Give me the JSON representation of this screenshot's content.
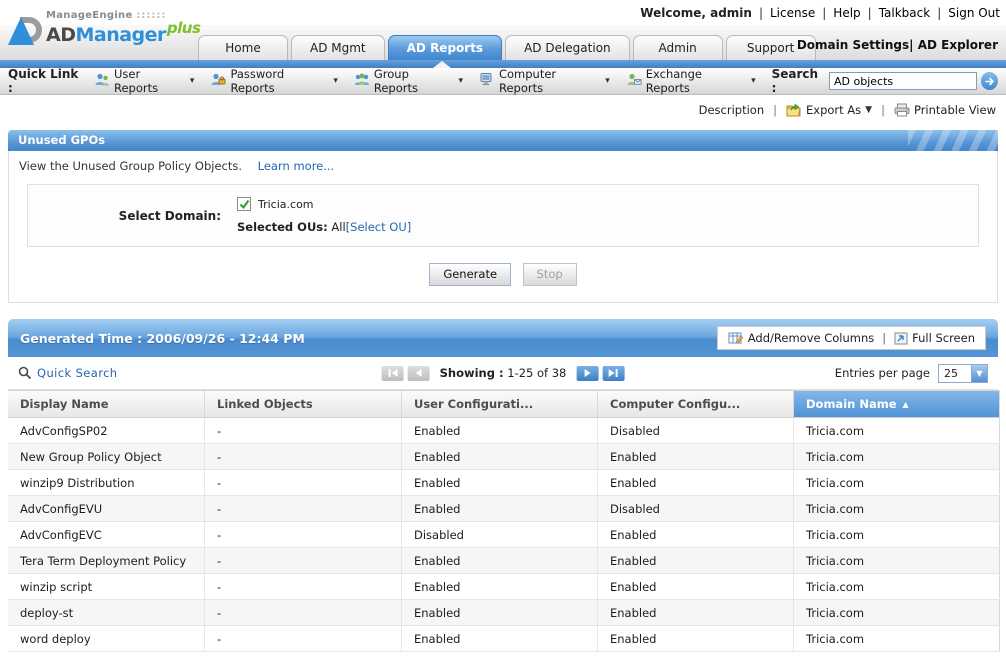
{
  "topbar": {
    "welcome": "Welcome, admin",
    "links": [
      "License",
      "Help",
      "Talkback",
      "Sign Out"
    ]
  },
  "brand": {
    "manage_engine": "ManageEngine",
    "dots": "::::::",
    "ad": "AD",
    "manager": "Manager",
    "plus": "plus"
  },
  "tabs": [
    {
      "label": "Home",
      "active": false
    },
    {
      "label": "AD Mgmt",
      "active": false
    },
    {
      "label": "AD Reports",
      "active": true
    },
    {
      "label": "AD Delegation",
      "active": false
    },
    {
      "label": "Admin",
      "active": false
    },
    {
      "label": "Support",
      "active": false
    }
  ],
  "mast_right": {
    "domain_settings": "Domain Settings",
    "divider": "|",
    "ad_explorer": "AD Explorer"
  },
  "quicklinks": {
    "label": "Quick Link :",
    "items": [
      {
        "label": "User Reports",
        "icon": "user-reports-icon"
      },
      {
        "label": "Password Reports",
        "icon": "password-reports-icon"
      },
      {
        "label": "Group Reports",
        "icon": "group-reports-icon"
      },
      {
        "label": "Computer Reports",
        "icon": "computer-reports-icon"
      },
      {
        "label": "Exchange Reports",
        "icon": "exchange-reports-icon"
      }
    ],
    "search_label": "Search :",
    "search_value": "AD objects"
  },
  "toolbar": {
    "description": "Description",
    "export_as": "Export As",
    "printable_view": "Printable View"
  },
  "report_panel": {
    "title": "Unused GPOs",
    "subtitle": "View the Unused Group Policy Objects.",
    "learn_more": "Learn more...",
    "select_domain_label": "Select Domain:",
    "domain_name": "Tricia.com",
    "domain_checked": true,
    "selected_ous_label": "Selected OUs:",
    "selected_ous_value": "All",
    "select_ou_link": "[Select OU]",
    "generate_button": "Generate",
    "stop_button": "Stop"
  },
  "results": {
    "generated_time": "Generated Time : 2006/09/26 - 12:44 PM",
    "add_remove_columns": "Add/Remove Columns",
    "tools_divider": "|",
    "full_screen": "Full Screen",
    "quick_search": "Quick Search",
    "showing_label": "Showing :",
    "showing_value": "1-25 of 38",
    "entries_per_page": "Entries per page",
    "entries_value": "25"
  },
  "table": {
    "columns": [
      "Display Name",
      "Linked Objects",
      "User Configurati...",
      "Computer Configu...",
      "Domain Name"
    ],
    "sorted_column_index": 4,
    "sort_direction": "asc",
    "rows": [
      [
        "AdvConfigSP02",
        "-",
        "Enabled",
        "Disabled",
        "Tricia.com"
      ],
      [
        "New Group Policy Object",
        "-",
        "Enabled",
        "Enabled",
        "Tricia.com"
      ],
      [
        "winzip9 Distribution",
        "-",
        "Enabled",
        "Enabled",
        "Tricia.com"
      ],
      [
        "AdvConfigEVU",
        "-",
        "Enabled",
        "Disabled",
        "Tricia.com"
      ],
      [
        "AdvConfigEVC",
        "-",
        "Disabled",
        "Enabled",
        "Tricia.com"
      ],
      [
        "Tera Term Deployment Policy",
        "-",
        "Enabled",
        "Enabled",
        "Tricia.com"
      ],
      [
        "winzip script",
        "-",
        "Enabled",
        "Enabled",
        "Tricia.com"
      ],
      [
        "deploy-st",
        "-",
        "Enabled",
        "Enabled",
        "Tricia.com"
      ],
      [
        "word deploy",
        "-",
        "Enabled",
        "Enabled",
        "Tricia.com"
      ]
    ]
  }
}
